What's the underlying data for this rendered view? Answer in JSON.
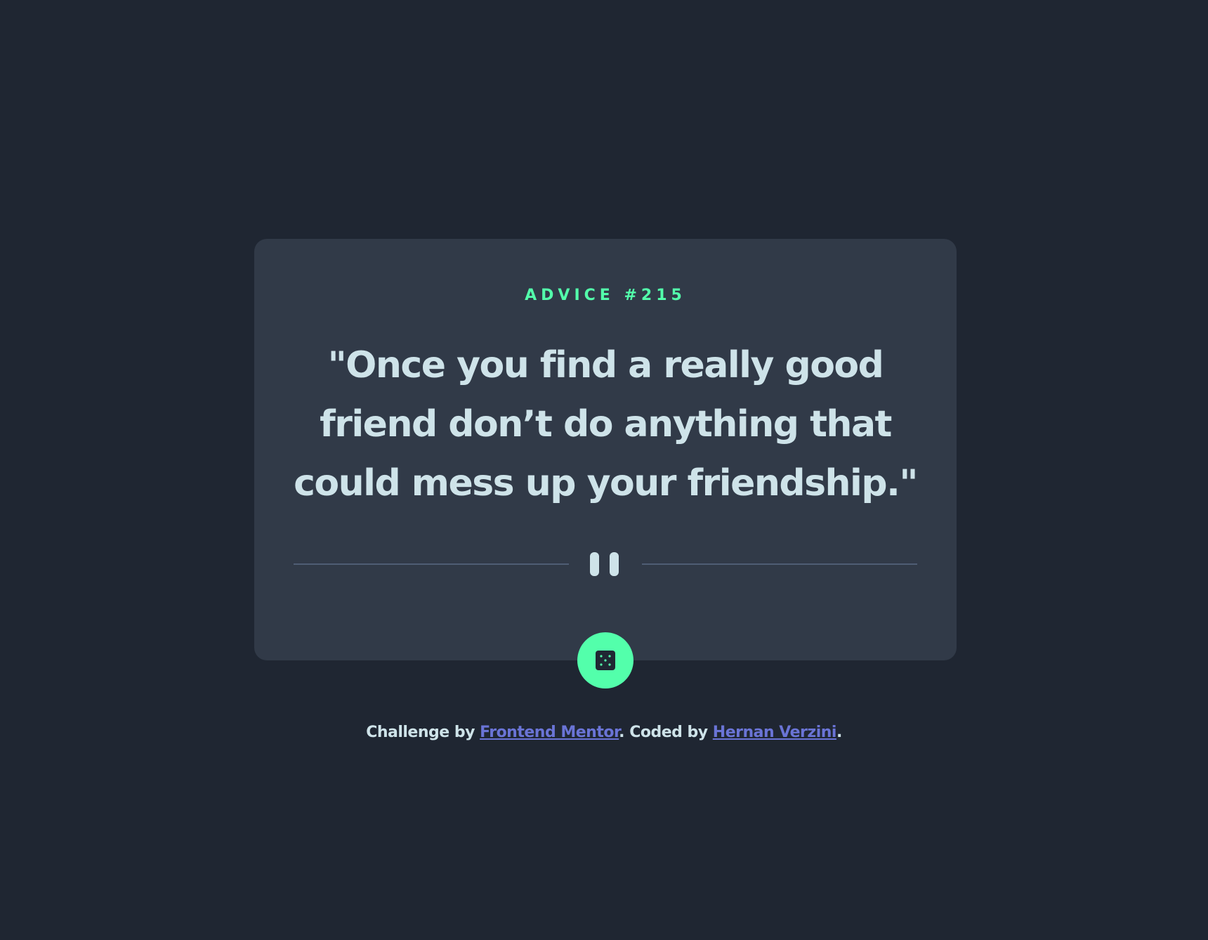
{
  "advice": {
    "number_label": "ADVICE #215",
    "quote": "\"Once you find a really good friend don’t do anything that could mess up your friendship.\""
  },
  "divider": {
    "icon": "pause-icon"
  },
  "dice_button": {
    "icon": "dice-icon"
  },
  "footer": {
    "challenge_prefix": "Challenge by ",
    "challenge_link": "Frontend Mentor",
    "coded_prefix": ". Coded by ",
    "coded_link": "Hernan Verzini",
    "suffix": "."
  },
  "colors": {
    "background": "#1f2632",
    "card": "#313a48",
    "accent": "#53ffab",
    "text": "#cee3e9",
    "link": "#6a74d6",
    "divider": "#4f5d74"
  }
}
